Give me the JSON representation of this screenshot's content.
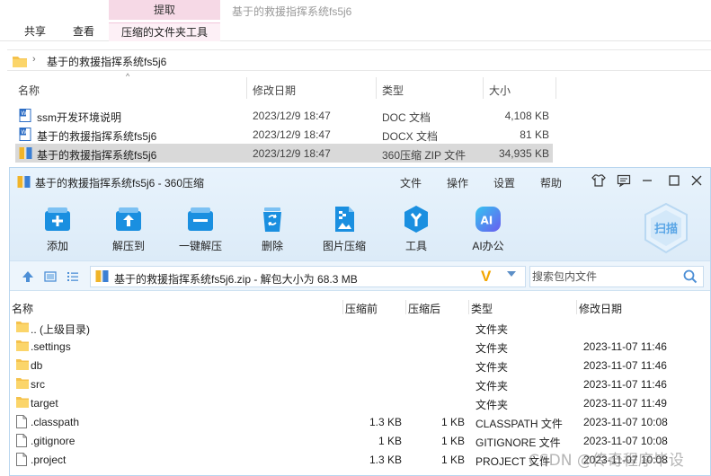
{
  "ribbon": {
    "context_group": "提取",
    "window_title": "基于的救援指挥系统fs5j6",
    "tabs": [
      "共享",
      "查看",
      "压缩的文件夹工具"
    ]
  },
  "address": {
    "separator": "›",
    "path": "基于的救援指挥系统fs5j6"
  },
  "explorer": {
    "sort_caret": "^",
    "columns": [
      "名称",
      "修改日期",
      "类型",
      "大小"
    ],
    "rows": [
      {
        "name": "ssm开发环境说明",
        "date": "2023/12/9 18:47",
        "type": "DOC 文档",
        "size": "4,108 KB",
        "icon": "word-doc-icon"
      },
      {
        "name": "基于的救援指挥系统fs5j6",
        "date": "2023/12/9 18:47",
        "type": "DOCX 文档",
        "size": "81 KB",
        "icon": "word-doc-icon"
      },
      {
        "name": "基于的救援指挥系统fs5j6",
        "date": "2023/12/9 18:47",
        "type": "360压缩 ZIP 文件",
        "size": "34,935 KB",
        "icon": "zip-archive-icon"
      }
    ]
  },
  "z360": {
    "title": "基于的救援指挥系统fs5j6 - 360压缩",
    "menu": [
      "文件",
      "操作",
      "设置",
      "帮助"
    ],
    "toolbar": [
      "添加",
      "解压到",
      "一键解压",
      "删除",
      "图片压缩",
      "工具",
      "AI办公"
    ],
    "ai_badge": "AI",
    "scan_label": "扫描",
    "path_text": "基于的救援指挥系统fs5j6.zip - 解包大小为 68.3 MB",
    "v_mark": "V",
    "search_placeholder": "搜索包内文件",
    "columns": [
      "名称",
      "压缩前",
      "压缩后",
      "类型",
      "修改日期"
    ],
    "rows": [
      {
        "name": ".. (上级目录)",
        "csize": "",
        "usize": "",
        "type": "文件夹",
        "mod": "",
        "kind": "folder"
      },
      {
        "name": ".settings",
        "csize": "",
        "usize": "",
        "type": "文件夹",
        "mod": "2023-11-07 11:46",
        "kind": "folder"
      },
      {
        "name": "db",
        "csize": "",
        "usize": "",
        "type": "文件夹",
        "mod": "2023-11-07 11:46",
        "kind": "folder"
      },
      {
        "name": "src",
        "csize": "",
        "usize": "",
        "type": "文件夹",
        "mod": "2023-11-07 11:46",
        "kind": "folder"
      },
      {
        "name": "target",
        "csize": "",
        "usize": "",
        "type": "文件夹",
        "mod": "2023-11-07 11:49",
        "kind": "folder"
      },
      {
        "name": ".classpath",
        "csize": "1.3 KB",
        "usize": "1 KB",
        "type": "CLASSPATH 文件",
        "mod": "2023-11-07 10:08",
        "kind": "file"
      },
      {
        "name": ".gitignore",
        "csize": "1 KB",
        "usize": "1 KB",
        "type": "GITIGNORE 文件",
        "mod": "2023-11-07 10:08",
        "kind": "file"
      },
      {
        "name": ".project",
        "csize": "1.3 KB",
        "usize": "1 KB",
        "type": "PROJECT 文件",
        "mod": "2023-11-07 10:08",
        "kind": "file"
      }
    ]
  },
  "watermark": "CSDN @传奇程序毕设",
  "colors": {
    "accent_blue": "#1a8fe0",
    "folder_yellow": "#f5c24c",
    "ribbon_pink": "#f6d9e6",
    "selection_gray": "#d9d9d9"
  }
}
